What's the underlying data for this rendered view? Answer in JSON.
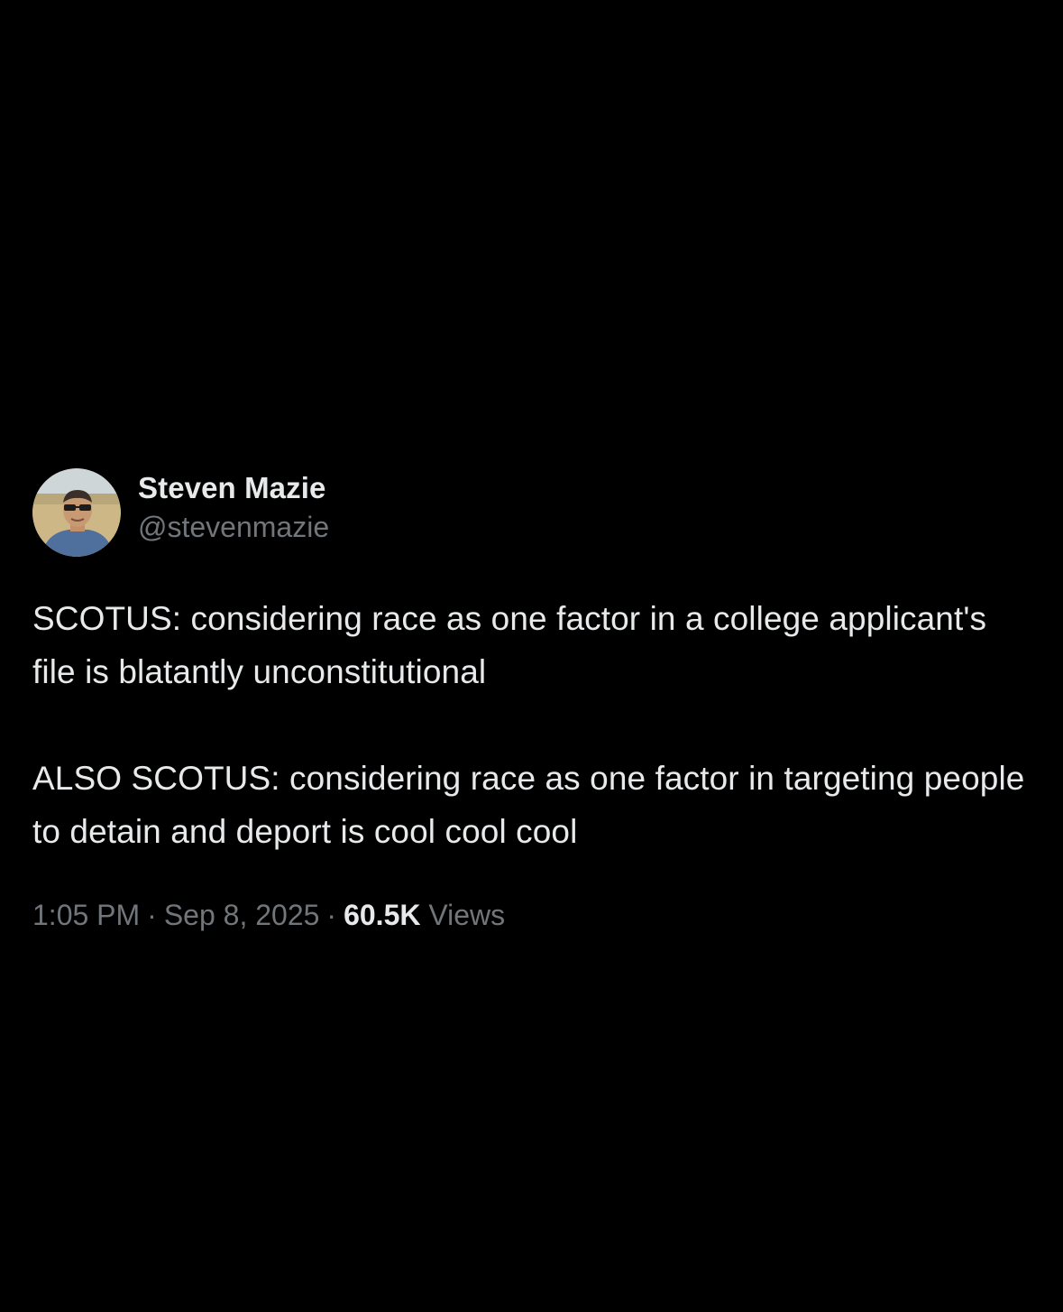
{
  "author": {
    "display_name": "Steven Mazie",
    "handle": "@stevenmazie"
  },
  "tweet": {
    "paragraphs": [
      "SCOTUS: considering race as one factor in a college applicant's file is blatantly unconstitutional",
      "ALSO SCOTUS: considering race as one factor in targeting people to detain and deport is cool cool cool"
    ]
  },
  "meta": {
    "time": "1:05 PM",
    "separator": "·",
    "date": "Sep 8, 2025",
    "views_count": "60.5K",
    "views_label": "Views"
  },
  "colors": {
    "background": "#000000",
    "primary_text": "#e7e9ea",
    "secondary_text": "#71767b"
  }
}
